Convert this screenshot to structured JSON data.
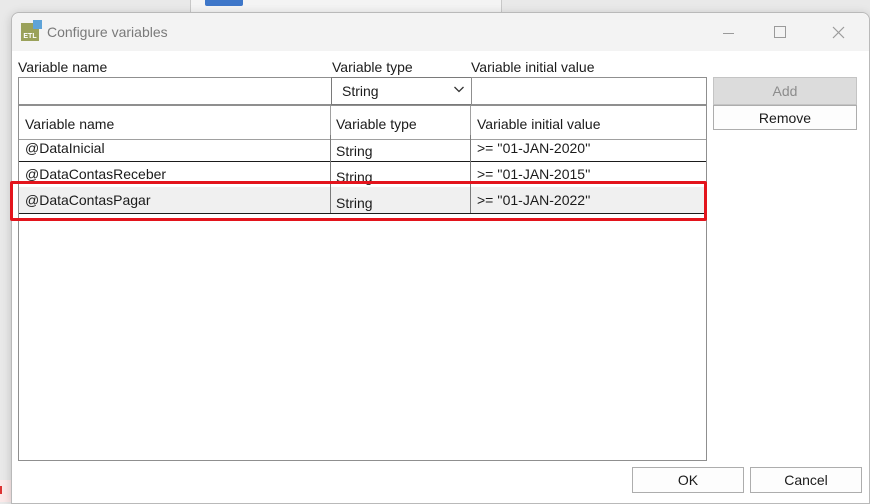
{
  "window": {
    "title": "Configure variables",
    "app_icon_text": "ETL"
  },
  "form": {
    "variable_name_label": "Variable name",
    "variable_name_value": "",
    "variable_type_label": "Variable type",
    "variable_type_value": "String",
    "initial_value_label": "Variable initial value",
    "initial_value_value": ""
  },
  "buttons": {
    "add": "Add",
    "remove": "Remove",
    "ok": "OK",
    "cancel": "Cancel"
  },
  "table": {
    "columns": [
      "Variable name",
      "Variable type",
      "Variable initial value"
    ],
    "rows": [
      {
        "name": "@DataInicial",
        "type": "String",
        "initial": ">= ''01-JAN-2020''"
      },
      {
        "name": "@DataContasReceber",
        "type": "String",
        "initial": ">= ''01-JAN-2015''"
      },
      {
        "name": "@DataContasPagar",
        "type": "String",
        "initial": ">= ''01-JAN-2022''"
      }
    ],
    "selected_row": 2
  },
  "colors": {
    "highlight": "#e3141c",
    "disabled_button": "#dcdcdc"
  }
}
